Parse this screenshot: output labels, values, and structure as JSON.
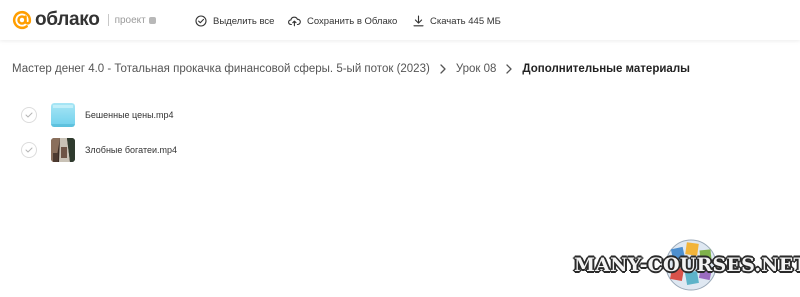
{
  "header": {
    "logo": {
      "name": "облако",
      "sub": "проект"
    },
    "actions": [
      {
        "label": "Выделить все",
        "icon": "check-circle-icon"
      },
      {
        "label": "Сохранить в Облако",
        "icon": "cloud-upload-icon"
      },
      {
        "label": "Скачать 445 МБ",
        "icon": "download-icon"
      }
    ]
  },
  "breadcrumb": [
    "Мастер денег 4.0 - Тотальная прокачка финансовой сферы. 5-ый поток (2023)",
    "Урок 08",
    "Дополнительные материалы"
  ],
  "files": [
    {
      "name": "Бешенные цены.mp4",
      "icon": "video-thumbnail"
    },
    {
      "name": "Злобные богатеи.mp4",
      "icon": "video-thumbnail"
    }
  ],
  "watermark": {
    "text": "MANY-COURSES.NET"
  },
  "colors": {
    "brand_orange": "#FF9E00",
    "text": "#333333",
    "muted": "#9A9A9A"
  }
}
